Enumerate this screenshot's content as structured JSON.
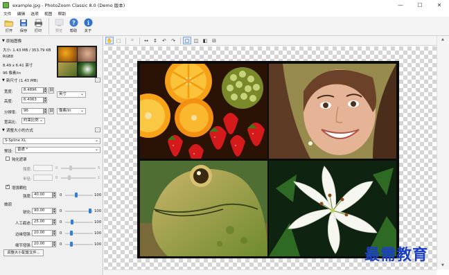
{
  "window": {
    "title": "example.jpg - PhotoZoom Classic 8.0 (Demo 版本)",
    "minimize": "—",
    "maximize": "☐",
    "close": "✕"
  },
  "menu": [
    "文件",
    "编辑",
    "选项",
    "视图",
    "帮助"
  ],
  "toolbar": [
    {
      "label": "打开",
      "icon": "open-folder-icon"
    },
    {
      "label": "保存",
      "icon": "save-disk-icon"
    },
    {
      "label": "打印",
      "icon": "printer-icon"
    },
    {
      "label": "预览",
      "icon": "preview-icon"
    },
    {
      "label": "帮助",
      "icon": "help-icon"
    },
    {
      "label": "关于",
      "icon": "info-icon"
    }
  ],
  "original": {
    "header": "原始图像",
    "size_line": "大小: 1.43 MB / 353.79 KB",
    "color_mode": "RGB8",
    "dimensions": "8.49 x 6.41 英寸",
    "resolution": "96 像素/in"
  },
  "new_size": {
    "header": "新尺寸 (1.43 MB)",
    "width_label": "宽度:",
    "width_value": "8.4896",
    "unit_value": "英寸",
    "height_label": "高度:",
    "height_value": "6.4063",
    "dpi_label": "分辨率:",
    "dpi_value": "96",
    "dpi_unit": "像素/in",
    "ratio_label": "宽高比:",
    "ratio_value": "约束比例"
  },
  "method": {
    "header": "调整大小的方式",
    "algorithm": "S-Spline XL",
    "preset_label": "预设:",
    "preset_value": "普通 *",
    "unsharp_label": "钝化遮罩",
    "unsharp_amount_label": "强度:",
    "unsharp_radius_label": "半径:",
    "unsharp_amount_min": "0",
    "unsharp_amount_max": "5",
    "unsharp_radius_min": "0",
    "unsharp_radius_max": "1",
    "clarity_label": "增强颗粒",
    "clarity_checked": true,
    "strength_label": "强度:",
    "strength_value": "40.00",
    "strength_min": "0",
    "strength_max": "100",
    "fine_tune_label": "微调",
    "sharpness_label": "锐化:",
    "sharpness_value": "90.00",
    "artifact_label": "人工痕迹:",
    "artifact_value": "25.00",
    "edge_label": "边缘增强:",
    "edge_value": "20.00",
    "detail_label": "细节增强:",
    "detail_value": "20.00",
    "row_min": "0",
    "row_max": "100",
    "profile_button": "调整大小配置文件..."
  },
  "watermark": "最需教育"
}
